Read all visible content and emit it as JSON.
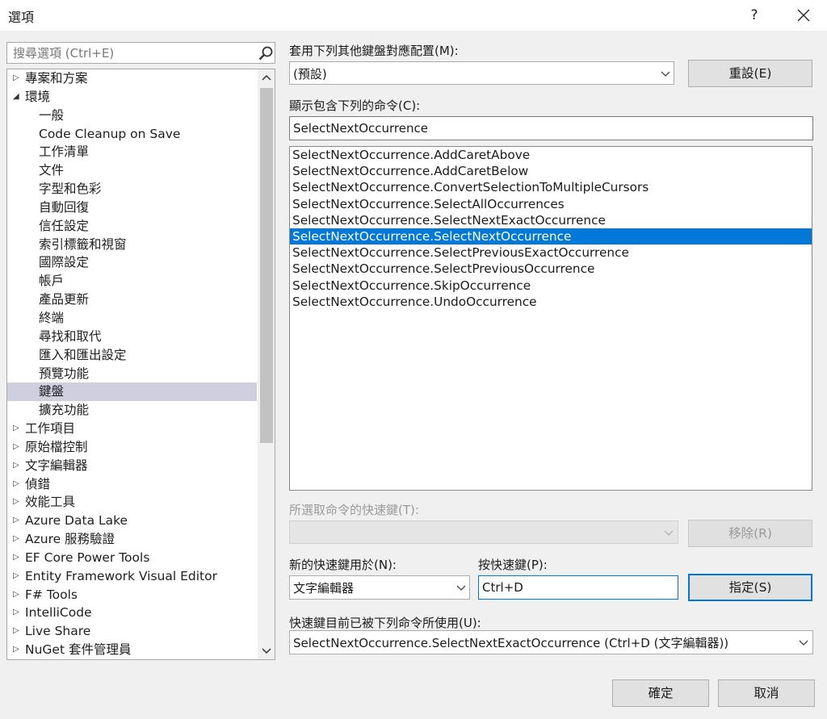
{
  "window": {
    "title": "選項",
    "help_label": "?"
  },
  "search": {
    "placeholder": "搜尋選項 (Ctrl+E)"
  },
  "tree": {
    "items": [
      {
        "label": "專案和方案",
        "level": 0,
        "expander": "▷"
      },
      {
        "label": "環境",
        "level": 0,
        "expander": "◢"
      },
      {
        "label": "一般",
        "level": 1
      },
      {
        "label": "Code Cleanup on Save",
        "level": 1
      },
      {
        "label": "工作清單",
        "level": 1
      },
      {
        "label": "文件",
        "level": 1
      },
      {
        "label": "字型和色彩",
        "level": 1
      },
      {
        "label": "自動回復",
        "level": 1
      },
      {
        "label": "信任設定",
        "level": 1
      },
      {
        "label": "索引標籤和視窗",
        "level": 1
      },
      {
        "label": "國際設定",
        "level": 1
      },
      {
        "label": "帳戶",
        "level": 1
      },
      {
        "label": "產品更新",
        "level": 1
      },
      {
        "label": "終端",
        "level": 1
      },
      {
        "label": "尋找和取代",
        "level": 1
      },
      {
        "label": "匯入和匯出設定",
        "level": 1
      },
      {
        "label": "預覽功能",
        "level": 1
      },
      {
        "label": "鍵盤",
        "level": 1,
        "selected": true
      },
      {
        "label": "擴充功能",
        "level": 1
      },
      {
        "label": "工作項目",
        "level": 0,
        "expander": "▷"
      },
      {
        "label": "原始檔控制",
        "level": 0,
        "expander": "▷"
      },
      {
        "label": "文字編輯器",
        "level": 0,
        "expander": "▷"
      },
      {
        "label": "偵錯",
        "level": 0,
        "expander": "▷"
      },
      {
        "label": "效能工具",
        "level": 0,
        "expander": "▷"
      },
      {
        "label": "Azure Data Lake",
        "level": 0,
        "expander": "▷"
      },
      {
        "label": "Azure 服務驗證",
        "level": 0,
        "expander": "▷"
      },
      {
        "label": "EF Core Power Tools",
        "level": 0,
        "expander": "▷"
      },
      {
        "label": "Entity Framework Visual Editor",
        "level": 0,
        "expander": "▷"
      },
      {
        "label": "F# Tools",
        "level": 0,
        "expander": "▷"
      },
      {
        "label": "IntelliCode",
        "level": 0,
        "expander": "▷"
      },
      {
        "label": "Live Share",
        "level": 0,
        "expander": "▷"
      },
      {
        "label": "NuGet 套件管理員",
        "level": 0,
        "expander": "▷"
      }
    ]
  },
  "mapping": {
    "label": "套用下列其他鍵盤對應配置(M):",
    "value": "(預設)",
    "reset_label": "重設(E)"
  },
  "show_commands": {
    "label": "顯示包含下列的命令(C):",
    "value": "SelectNextOccurrence"
  },
  "commands": [
    {
      "text": "SelectNextOccurrence.AddCaretAbove"
    },
    {
      "text": "SelectNextOccurrence.AddCaretBelow"
    },
    {
      "text": "SelectNextOccurrence.ConvertSelectionToMultipleCursors"
    },
    {
      "text": "SelectNextOccurrence.SelectAllOccurrences"
    },
    {
      "text": "SelectNextOccurrence.SelectNextExactOccurrence"
    },
    {
      "text": "SelectNextOccurrence.SelectNextOccurrence",
      "selected": true
    },
    {
      "text": "SelectNextOccurrence.SelectPreviousExactOccurrence"
    },
    {
      "text": "SelectNextOccurrence.SelectPreviousOccurrence"
    },
    {
      "text": "SelectNextOccurrence.SkipOccurrence"
    },
    {
      "text": "SelectNextOccurrence.UndoOccurrence"
    }
  ],
  "shortcuts": {
    "label": "所選取命令的快速鍵(T):",
    "value": "",
    "remove_label": "移除(R)"
  },
  "new_shortcut": {
    "scope_label": "新的快速鍵用於(N):",
    "scope_value": "文字編輯器",
    "press_label": "按快速鍵(P):",
    "press_value": "Ctrl+D",
    "assign_label": "指定(S)"
  },
  "currently_used": {
    "label": "快速鍵目前已被下列命令所使用(U):",
    "value": "SelectNextOccurrence.SelectNextExactOccurrence (Ctrl+D (文字編輯器))"
  },
  "footer": {
    "ok_label": "確定",
    "cancel_label": "取消"
  },
  "colors": {
    "selection_blue": "#0078d7",
    "tree_selection": "#cfcfe0",
    "dialog_bg": "#f0f0f0"
  }
}
